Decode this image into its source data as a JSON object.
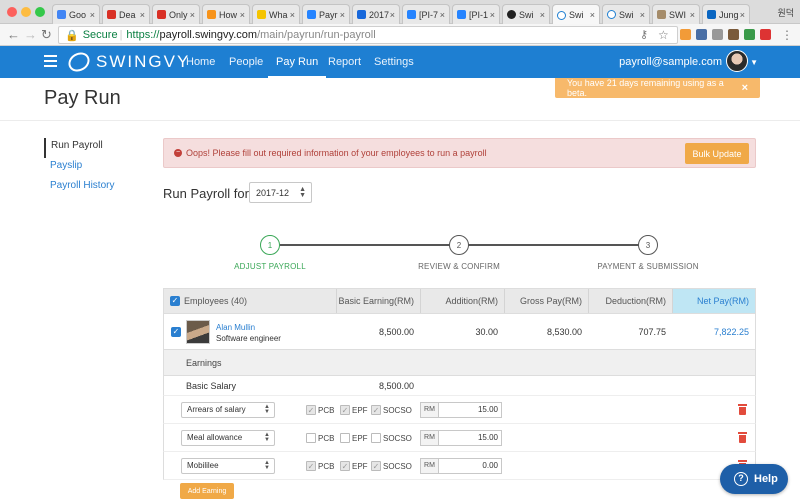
{
  "browser": {
    "tabs": [
      {
        "label": "Goo"
      },
      {
        "label": "Dea"
      },
      {
        "label": "Only"
      },
      {
        "label": "How"
      },
      {
        "label": "Wha"
      },
      {
        "label": "Payr"
      },
      {
        "label": "2017"
      },
      {
        "label": "[PI-7"
      },
      {
        "label": "[PI-1"
      },
      {
        "label": "Swi"
      },
      {
        "label": "Swi"
      },
      {
        "label": "Swi"
      },
      {
        "label": "SWI"
      },
      {
        "label": "Jung"
      }
    ],
    "profile_label": "원덕",
    "secure_label": "Secure",
    "url_protocol": "https://",
    "url_host": "payroll.swingvy.com",
    "url_path": "/main/payrun/run-payroll"
  },
  "navbar": {
    "brand": "SWINGVY",
    "links": [
      "Home",
      "People",
      "Pay Run",
      "Report",
      "Settings"
    ],
    "active_link": "Pay Run",
    "user_email": "payroll@sample.com",
    "color": "#1e7fd2"
  },
  "page": {
    "title": "Pay Run",
    "beta_notice": "You have 21 days remaining using as a beta."
  },
  "sidebar": {
    "items": [
      "Run Payroll",
      "Payslip",
      "Payroll History"
    ],
    "active": "Run Payroll"
  },
  "alert": {
    "message": "Oops! Please fill out required information of your employees to run a payroll",
    "button": "Bulk Update"
  },
  "run_payroll": {
    "label": "Run Payroll for",
    "period": "2017-12"
  },
  "stepper": {
    "steps": [
      {
        "number": "1",
        "label": "ADJUST PAYROLL",
        "state": "current"
      },
      {
        "number": "2",
        "label": "REVIEW & CONFIRM",
        "state": "pending"
      },
      {
        "number": "3",
        "label": "PAYMENT & SUBMISSION",
        "state": "pending"
      }
    ]
  },
  "table": {
    "headers": {
      "employees": "Employees (40)",
      "basic": "Basic Earning(RM)",
      "addition": "Addition(RM)",
      "gross": "Gross Pay(RM)",
      "deduction": "Deduction(RM)",
      "net": "Net Pay(RM)"
    },
    "employee": {
      "name": "Alan Mullin",
      "title": "Software engineer",
      "basic": "8,500.00",
      "addition": "30.00",
      "gross": "8,530.00",
      "deduction": "707.75",
      "net": "7,822.25"
    },
    "earnings": {
      "section_label": "Earnings",
      "basic_salary_label": "Basic Salary",
      "basic_salary_value": "8,500.00",
      "currency_prefix": "RM",
      "rows": [
        {
          "type": "Arrears of salary",
          "pcb": true,
          "epf": true,
          "socso": true,
          "amount": "15.00"
        },
        {
          "type": "Meal allowance",
          "pcb": false,
          "epf": false,
          "socso": false,
          "amount": "15.00"
        },
        {
          "type": "Mobililee",
          "pcb": true,
          "epf": true,
          "socso": true,
          "amount": "0.00"
        }
      ],
      "check_labels": {
        "pcb": "PCB",
        "epf": "EPF",
        "socso": "SOCSO"
      },
      "add_button": "Add Earning"
    }
  },
  "help": {
    "label": "Help"
  }
}
